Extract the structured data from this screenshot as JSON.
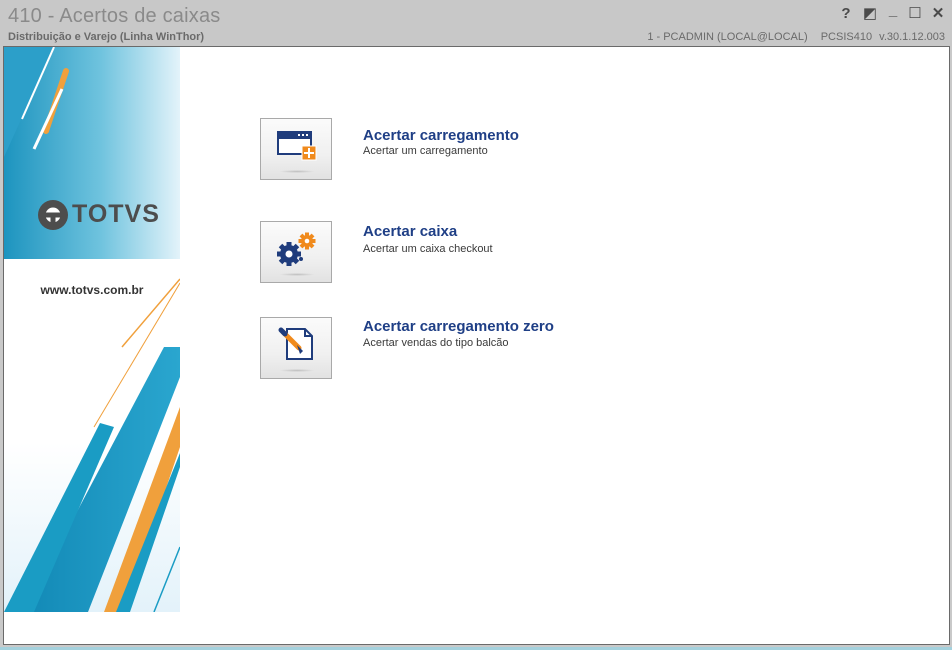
{
  "window": {
    "title": "410 - Acertos de caixas",
    "subtitle": "Distribuição e Varejo (Linha WinThor)",
    "user": "1 - PCADMIN (LOCAL@LOCAL)",
    "program": "PCSIS410",
    "version": "v.30.1.12.003",
    "controls": {
      "help": "?",
      "restore": "◩",
      "minimize": "_",
      "maximize": "☐",
      "close": "✕"
    }
  },
  "brand": {
    "logo_text": "TOTVS",
    "website": "www.totvs.com.br",
    "colors": {
      "blue": "#1a9cc4",
      "orange": "#f0a03c",
      "grey": "#4d4d4d"
    }
  },
  "actions": [
    {
      "icon": "window-add-icon",
      "title": "Acertar carregamento",
      "description": "Acertar um carregamento"
    },
    {
      "icon": "gears-icon",
      "title": "Acertar caixa",
      "description": "Acertar um caixa checkout"
    },
    {
      "icon": "document-pen-icon",
      "title": "Acertar carregamento zero",
      "description": "Acertar vendas do tipo balcão"
    }
  ],
  "colors": {
    "title_link": "#1f3f86",
    "accent_orange": "#f08a1c",
    "icon_navy": "#1f3c7c"
  }
}
